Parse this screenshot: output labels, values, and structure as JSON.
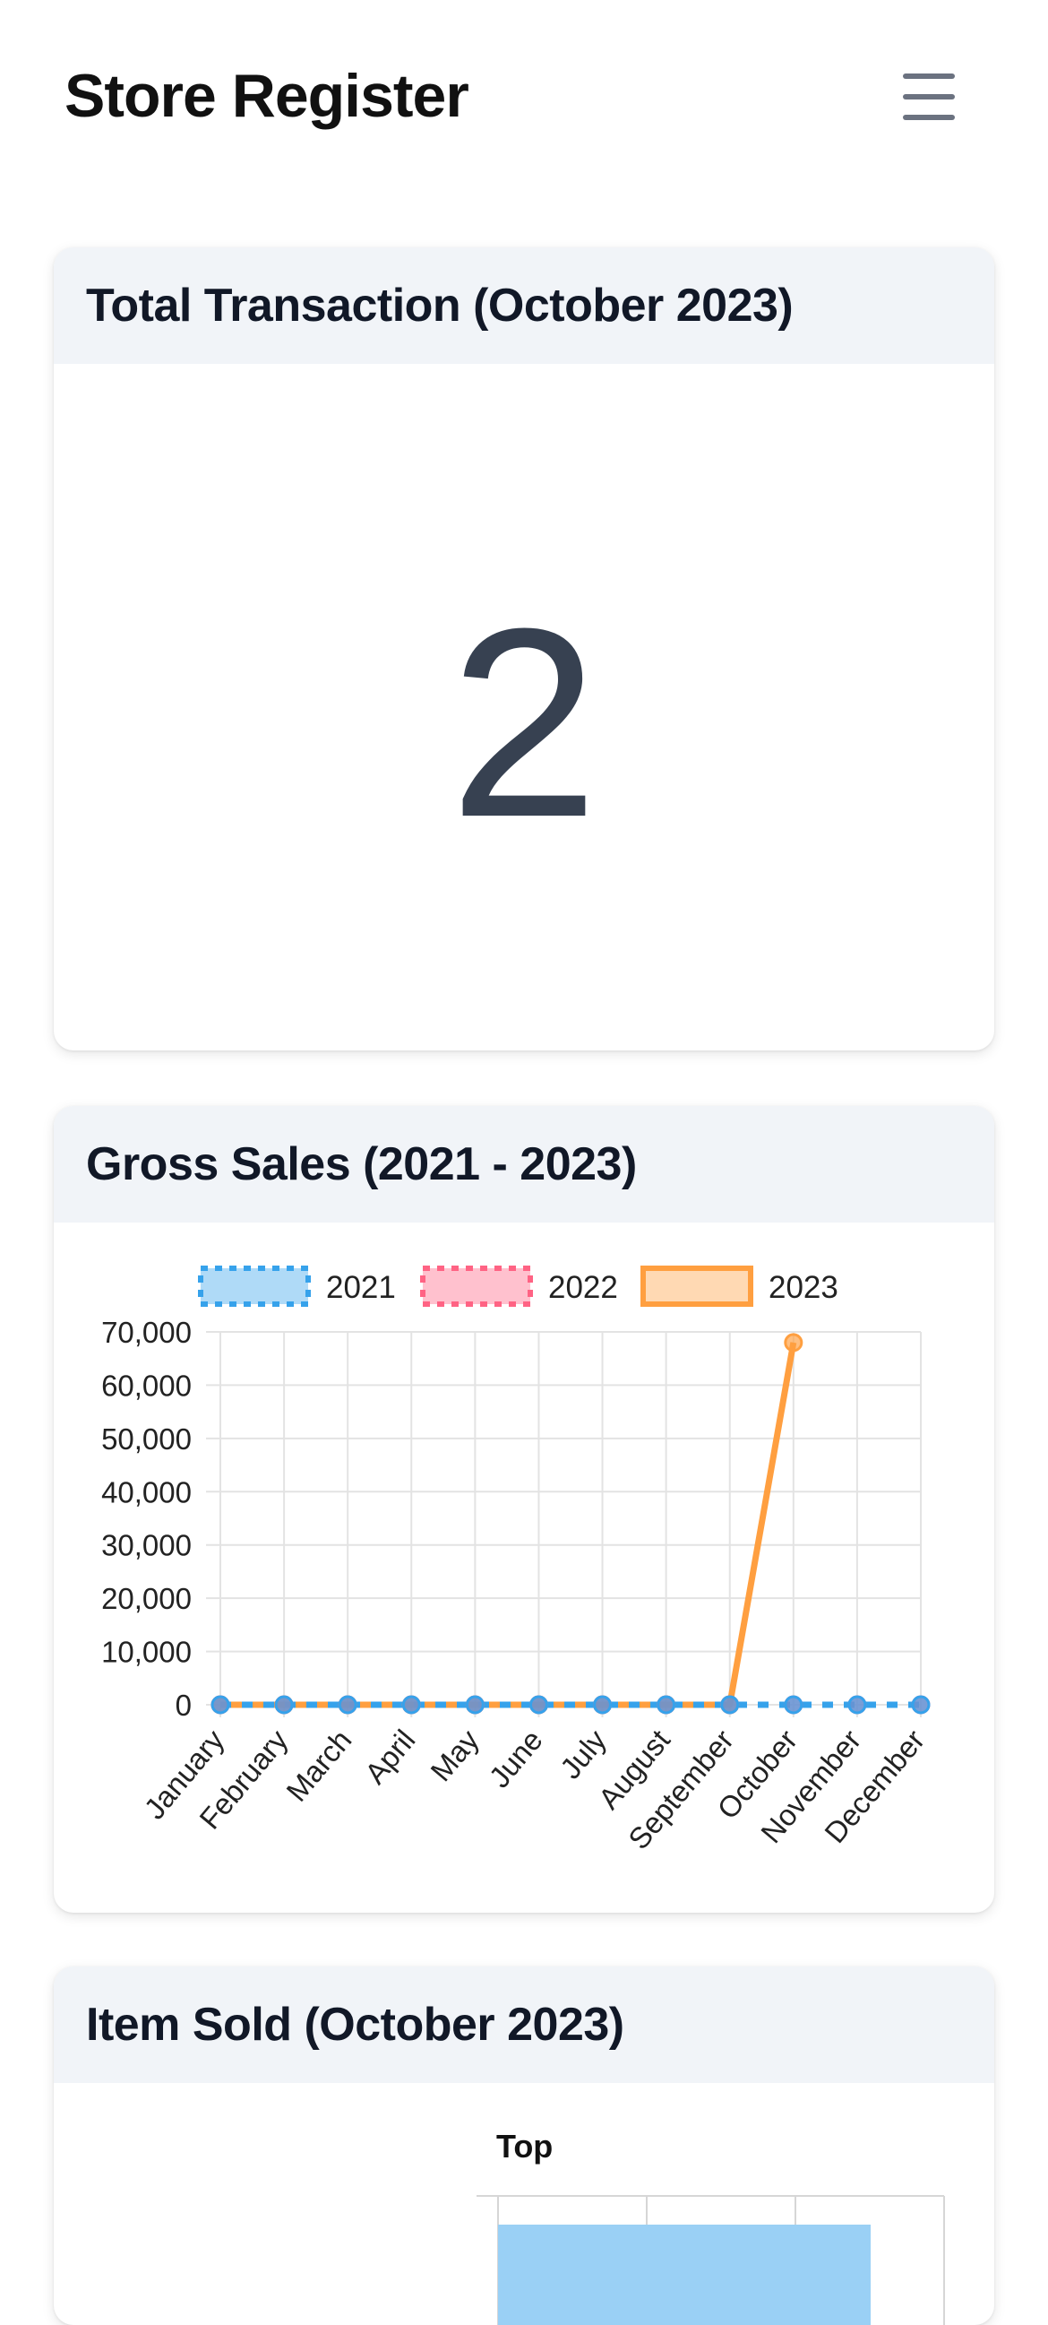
{
  "header": {
    "title": "Store Register",
    "menu_icon": "hamburger-menu-icon"
  },
  "total_transaction": {
    "title": "Total Transaction (October 2023)",
    "value": "2"
  },
  "gross_sales": {
    "title": "Gross Sales (2021 - 2023)"
  },
  "item_sold": {
    "title": "Item Sold (October 2023)",
    "subtitle": "Top"
  },
  "colors": {
    "series_2021": "#36a2eb",
    "series_2022": "#ff6384",
    "series_2023": "#ff9f40",
    "header_bg": "#f1f4f8",
    "value_text": "#374151"
  },
  "chart_data": [
    {
      "type": "line",
      "title": "",
      "categories": [
        "January",
        "February",
        "March",
        "April",
        "May",
        "June",
        "July",
        "August",
        "September",
        "October",
        "November",
        "December"
      ],
      "ylim": [
        0,
        70000
      ],
      "yticks": [
        "0",
        "10,000",
        "20,000",
        "30,000",
        "40,000",
        "50,000",
        "60,000",
        "70,000"
      ],
      "grid": true,
      "legend": "top",
      "series": [
        {
          "name": "2021",
          "color": "#36a2eb",
          "dashed": true,
          "values": [
            0,
            0,
            0,
            0,
            0,
            0,
            0,
            0,
            0,
            0,
            0,
            0
          ]
        },
        {
          "name": "2022",
          "color": "#ff6384",
          "dashed": true,
          "values": [
            0,
            0,
            0,
            0,
            0,
            0,
            0,
            0,
            0,
            0,
            0,
            0
          ]
        },
        {
          "name": "2023",
          "color": "#ff9f40",
          "dashed": false,
          "values": [
            0,
            0,
            0,
            0,
            0,
            0,
            0,
            0,
            0,
            68000,
            null,
            null
          ]
        }
      ]
    }
  ]
}
